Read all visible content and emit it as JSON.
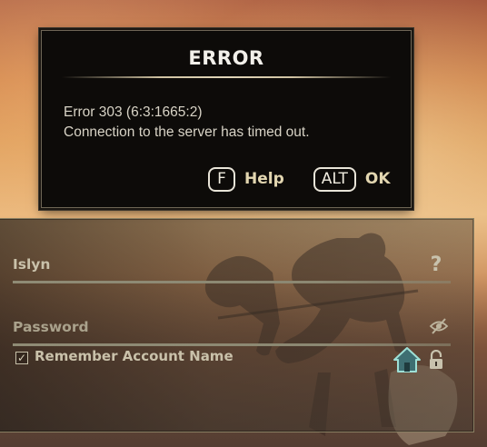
{
  "dialog": {
    "title": "ERROR",
    "message_line1": "Error 303 (6:3:1665:2)",
    "message_line2": "Connection to the server has timed out.",
    "help_key": "F",
    "help_label": "Help",
    "ok_key": "ALT",
    "ok_label": "OK"
  },
  "login": {
    "account_value": "Islyn",
    "password_placeholder": "Password",
    "remember_label": "Remember Account Name",
    "remember_checked": true,
    "help_glyph": "?",
    "checkbox_glyph": "✓"
  },
  "colors": {
    "dialog_bg": "#0d0b09",
    "accent_text": "#e2d6b0",
    "home_icon": "#8fd1c9"
  },
  "icons": [
    "help-icon",
    "eye-slash-icon",
    "home-icon",
    "lock-icon"
  ]
}
